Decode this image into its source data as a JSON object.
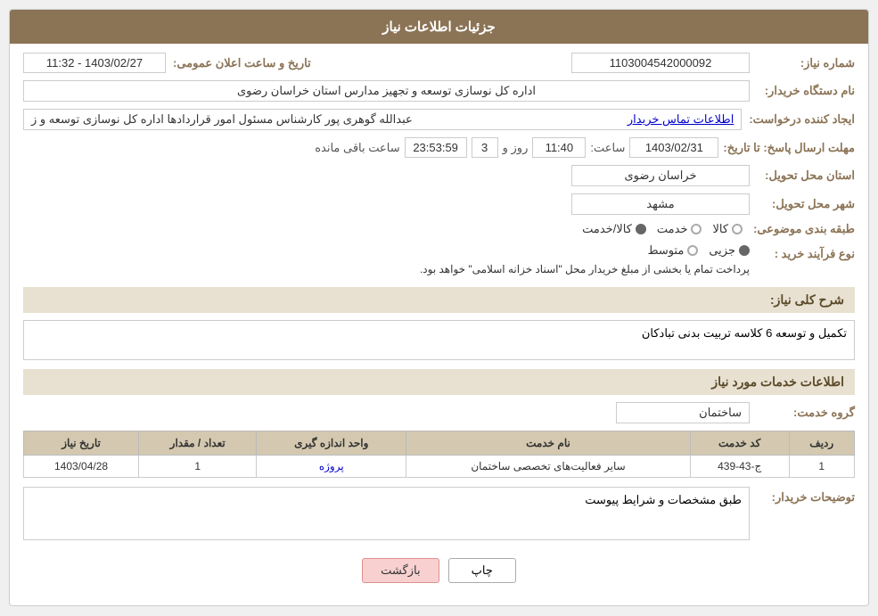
{
  "header": {
    "title": "جزئیات اطلاعات نیاز"
  },
  "fields": {
    "need_number_label": "شماره نیاز:",
    "need_number_value": "1103004542000092",
    "buyer_org_label": "نام دستگاه خریدار:",
    "buyer_org_value": "اداره کل نوسازی  توسعه و تجهیز مدارس استان خراسان رضوی",
    "creator_label": "ایجاد کننده درخواست:",
    "creator_value": "عبدالله گوهری پور کارشناس مسئول امور قراردادها  اداره کل نوسازی  توسعه و ز",
    "creator_link": "اطلاعات تماس خریدار",
    "deadline_label": "مهلت ارسال پاسخ: تا تاریخ:",
    "deadline_date": "1403/02/31",
    "deadline_time_label": "ساعت:",
    "deadline_time": "11:40",
    "deadline_day_label": "روز و",
    "deadline_day": "3",
    "deadline_remain_label": "ساعت باقی مانده",
    "deadline_remain": "23:53:59",
    "announce_label": "تاریخ و ساعت اعلان عمومی:",
    "announce_value": "1403/02/27 - 11:32",
    "province_label": "استان محل تحویل:",
    "province_value": "خراسان رضوی",
    "city_label": "شهر محل تحویل:",
    "city_value": "مشهد",
    "category_label": "طبقه بندی موضوعی:",
    "category_options": [
      {
        "label": "کالا",
        "selected": false
      },
      {
        "label": "خدمت",
        "selected": false
      },
      {
        "label": "کالا/خدمت",
        "selected": true
      }
    ],
    "process_label": "نوع فرآیند خرید :",
    "process_options": [
      {
        "label": "جزیی",
        "selected": true
      },
      {
        "label": "متوسط",
        "selected": false
      }
    ],
    "process_desc": "پرداخت تمام یا بخشی از مبلغ خریدار محل \"اسناد خزانه اسلامی\" خواهد بود.",
    "need_summary_label": "شرح کلی نیاز:",
    "need_summary_value": "تکمیل و توسعه 6 کلاسه تربیت بدنی تبادکان",
    "service_info_title": "اطلاعات خدمات مورد نیاز",
    "service_group_label": "گروه خدمت:",
    "service_group_value": "ساختمان",
    "table": {
      "headers": [
        "ردیف",
        "کد خدمت",
        "نام خدمت",
        "واحد اندازه گیری",
        "تعداد / مقدار",
        "تاریخ نیاز"
      ],
      "rows": [
        {
          "row": "1",
          "code": "ج-43-439",
          "name": "سایر فعالیت‌های تخصصی ساختمان",
          "unit": "پروژه",
          "count": "1",
          "date": "1403/04/28"
        }
      ]
    },
    "buyer_desc_label": "توضیحات خریدار:",
    "buyer_desc_value": "طبق مشخصات و شرایط پیوست"
  },
  "buttons": {
    "print_label": "چاپ",
    "back_label": "بازگشت"
  }
}
